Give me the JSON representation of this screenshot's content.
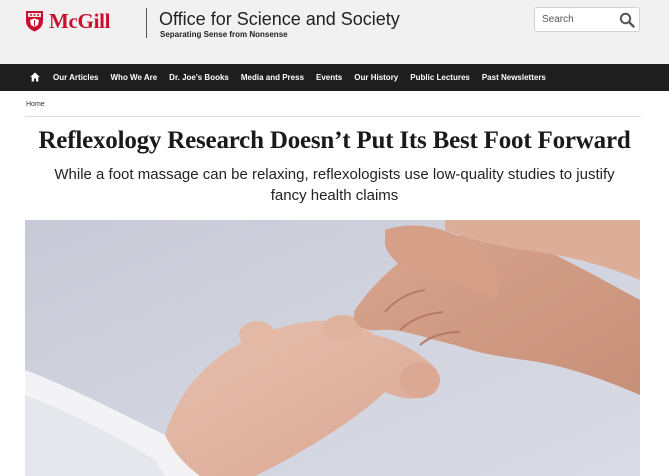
{
  "header": {
    "logo_text": "McGill",
    "site_title": "Office for Science and Society",
    "site_subtitle": "Separating Sense from Nonsense",
    "search_placeholder": "Search",
    "brand_color": "#c8102e"
  },
  "nav": {
    "home_icon": "home-icon",
    "items": [
      {
        "label": "Our Articles"
      },
      {
        "label": "Who We Are"
      },
      {
        "label": "Dr. Joe's Books"
      },
      {
        "label": "Media and Press"
      },
      {
        "label": "Events"
      },
      {
        "label": "Our History"
      },
      {
        "label": "Public Lectures"
      },
      {
        "label": "Past Newsletters"
      }
    ]
  },
  "breadcrumb": {
    "home": "Home"
  },
  "article": {
    "title": "Reflexology Research Doesn’t Put Its Best Foot Forward",
    "subtitle": "While a foot massage can be relaxing, reflexologists use low-quality studies to justify fancy health claims"
  }
}
